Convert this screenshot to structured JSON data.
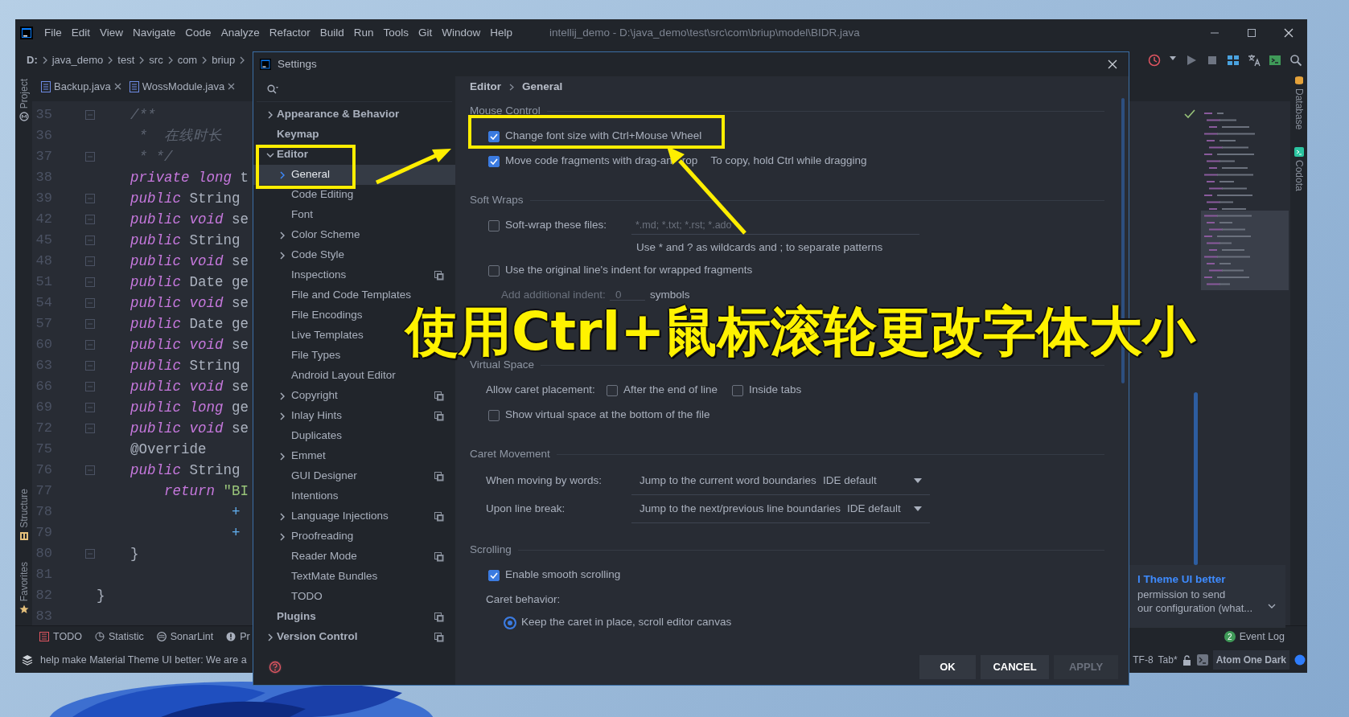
{
  "ide": {
    "menu": [
      "File",
      "Edit",
      "View",
      "Navigate",
      "Code",
      "Analyze",
      "Refactor",
      "Build",
      "Run",
      "Tools",
      "Git",
      "Window",
      "Help"
    ],
    "title": "intellij_demo - D:\\java_demo\\test\\src\\com\\briup\\model\\BIDR.java",
    "breadcrumbs": [
      "D:",
      "java_demo",
      "test",
      "src",
      "com",
      "briup"
    ],
    "tabs": [
      {
        "label": "Backup.java",
        "selected": false
      },
      {
        "label": "WossModule.java",
        "selected": false
      }
    ],
    "left_tools": [
      "Project",
      "Structure",
      "Favorites"
    ],
    "right_tools": [
      "Database",
      "Codota"
    ],
    "code_lines": [
      {
        "number": "35",
        "fold": true,
        "tokens": [
          {
            "kind": "comment",
            "text": "    /**"
          }
        ]
      },
      {
        "number": "36",
        "fold": false,
        "tokens": [
          {
            "kind": "comment",
            "text": "     *  在线时长"
          }
        ]
      },
      {
        "number": "37",
        "fold": true,
        "tokens": [
          {
            "kind": "comment",
            "text": "     * */"
          }
        ]
      },
      {
        "number": "38",
        "fold": false,
        "tokens": [
          {
            "kind": "keyword",
            "text": "    private"
          },
          {
            "kind": "keyword",
            "text": " long"
          },
          {
            "kind": "plain",
            "text": " t"
          }
        ]
      },
      {
        "number": "39",
        "fold": true,
        "tokens": [
          {
            "kind": "keyword",
            "text": "    public"
          },
          {
            "kind": "plain",
            "text": " String"
          }
        ]
      },
      {
        "number": "42",
        "fold": true,
        "tokens": [
          {
            "kind": "keyword",
            "text": "    public"
          },
          {
            "kind": "keyword",
            "text": " void"
          },
          {
            "kind": "plain",
            "text": " se"
          }
        ]
      },
      {
        "number": "45",
        "fold": true,
        "tokens": [
          {
            "kind": "keyword",
            "text": "    public"
          },
          {
            "kind": "plain",
            "text": " String"
          }
        ]
      },
      {
        "number": "48",
        "fold": true,
        "tokens": [
          {
            "kind": "keyword",
            "text": "    public"
          },
          {
            "kind": "keyword",
            "text": " void"
          },
          {
            "kind": "plain",
            "text": " se"
          }
        ]
      },
      {
        "number": "51",
        "fold": true,
        "tokens": [
          {
            "kind": "keyword",
            "text": "    public"
          },
          {
            "kind": "plain",
            "text": " Date ge"
          }
        ]
      },
      {
        "number": "54",
        "fold": true,
        "tokens": [
          {
            "kind": "keyword",
            "text": "    public"
          },
          {
            "kind": "keyword",
            "text": " void"
          },
          {
            "kind": "plain",
            "text": " se"
          }
        ]
      },
      {
        "number": "57",
        "fold": true,
        "tokens": [
          {
            "kind": "keyword",
            "text": "    public"
          },
          {
            "kind": "plain",
            "text": " Date ge"
          }
        ]
      },
      {
        "number": "60",
        "fold": true,
        "tokens": [
          {
            "kind": "keyword",
            "text": "    public"
          },
          {
            "kind": "keyword",
            "text": " void"
          },
          {
            "kind": "plain",
            "text": " se"
          }
        ]
      },
      {
        "number": "63",
        "fold": true,
        "tokens": [
          {
            "kind": "keyword",
            "text": "    public"
          },
          {
            "kind": "plain",
            "text": " String"
          }
        ]
      },
      {
        "number": "66",
        "fold": true,
        "tokens": [
          {
            "kind": "keyword",
            "text": "    public"
          },
          {
            "kind": "keyword",
            "text": " void"
          },
          {
            "kind": "plain",
            "text": " se"
          }
        ]
      },
      {
        "number": "69",
        "fold": true,
        "tokens": [
          {
            "kind": "keyword",
            "text": "    public"
          },
          {
            "kind": "keyword",
            "text": " long"
          },
          {
            "kind": "plain",
            "text": " ge"
          }
        ]
      },
      {
        "number": "72",
        "fold": true,
        "tokens": [
          {
            "kind": "keyword",
            "text": "    public"
          },
          {
            "kind": "keyword",
            "text": " void"
          },
          {
            "kind": "plain",
            "text": " se"
          }
        ]
      },
      {
        "number": "75",
        "fold": false,
        "tokens": [
          {
            "kind": "plain",
            "text": "    @Override"
          }
        ]
      },
      {
        "number": "76",
        "fold": true,
        "tokens": [
          {
            "kind": "keyword",
            "text": "    public"
          },
          {
            "kind": "plain",
            "text": " String"
          }
        ]
      },
      {
        "number": "77",
        "fold": false,
        "tokens": [
          {
            "kind": "keyword",
            "text": "        return"
          },
          {
            "kind": "string",
            "text": " \"BI"
          }
        ]
      },
      {
        "number": "78",
        "fold": false,
        "tokens": [
          {
            "kind": "operator",
            "text": "                +"
          }
        ]
      },
      {
        "number": "79",
        "fold": false,
        "tokens": [
          {
            "kind": "operator",
            "text": "                +"
          }
        ]
      },
      {
        "number": "80",
        "fold": true,
        "tokens": [
          {
            "kind": "plain",
            "text": "    }"
          }
        ]
      },
      {
        "number": "81",
        "fold": false
      },
      {
        "number": "82",
        "fold": false,
        "tokens": [
          {
            "kind": "plain",
            "text": "}"
          }
        ]
      },
      {
        "number": "83",
        "fold": false
      }
    ],
    "notification": {
      "title": "l Theme UI better",
      "lines": [
        "permission to send",
        "our configuration (what..."
      ]
    },
    "bottom_tools": [
      "TODO",
      "Statistic",
      "SonarLint",
      "Pr"
    ],
    "event_log": {
      "count": "2",
      "label": "Event Log"
    },
    "status": {
      "message": "help make Material Theme UI better: We are a",
      "encoding": "TF-8",
      "indent": "Tab*",
      "theme": "Atom One Dark"
    }
  },
  "settings": {
    "title": "Settings",
    "tree": [
      {
        "label": "Appearance & Behavior",
        "kind": "group",
        "expanded": false,
        "selected": false,
        "project": false
      },
      {
        "label": "Keymap",
        "kind": "page",
        "selected": false,
        "project": false
      },
      {
        "label": "Editor",
        "kind": "group",
        "expanded": true,
        "selected": false,
        "project": false,
        "children": [
          {
            "label": "General",
            "kind": "group",
            "expanded": false,
            "selected": true,
            "project": false
          },
          {
            "label": "Code Editing",
            "kind": "page",
            "selected": false,
            "project": false
          },
          {
            "label": "Font",
            "kind": "page",
            "selected": false,
            "project": false
          },
          {
            "label": "Color Scheme",
            "kind": "group",
            "expanded": false,
            "selected": false,
            "project": false
          },
          {
            "label": "Code Style",
            "kind": "group",
            "expanded": false,
            "selected": false,
            "project": false
          },
          {
            "label": "Inspections",
            "kind": "page",
            "selected": false,
            "project": true
          },
          {
            "label": "File and Code Templates",
            "kind": "page",
            "selected": false,
            "project": false
          },
          {
            "label": "File Encodings",
            "kind": "page",
            "selected": false,
            "project": false
          },
          {
            "label": "Live Templates",
            "kind": "page",
            "selected": false,
            "project": false
          },
          {
            "label": "File Types",
            "kind": "page",
            "selected": false,
            "project": false
          },
          {
            "label": "Android Layout Editor",
            "kind": "page",
            "selected": false,
            "project": false
          },
          {
            "label": "Copyright",
            "kind": "group",
            "expanded": false,
            "selected": false,
            "project": true
          },
          {
            "label": "Inlay Hints",
            "kind": "group",
            "expanded": false,
            "selected": false,
            "project": true
          },
          {
            "label": "Duplicates",
            "kind": "page",
            "selected": false,
            "project": false
          },
          {
            "label": "Emmet",
            "kind": "group",
            "expanded": false,
            "selected": false,
            "project": false
          },
          {
            "label": "GUI Designer",
            "kind": "page",
            "selected": false,
            "project": true
          },
          {
            "label": "Intentions",
            "kind": "page",
            "selected": false,
            "project": false
          },
          {
            "label": "Language Injections",
            "kind": "group",
            "expanded": false,
            "selected": false,
            "project": true
          },
          {
            "label": "Proofreading",
            "kind": "group",
            "expanded": false,
            "selected": false,
            "project": false
          },
          {
            "label": "Reader Mode",
            "kind": "page",
            "selected": false,
            "project": true
          },
          {
            "label": "TextMate Bundles",
            "kind": "page",
            "selected": false,
            "project": false
          },
          {
            "label": "TODO",
            "kind": "page",
            "selected": false,
            "project": false
          }
        ]
      },
      {
        "label": "Plugins",
        "kind": "page",
        "selected": false,
        "project": true
      },
      {
        "label": "Version Control",
        "kind": "group",
        "expanded": false,
        "selected": false,
        "project": true
      }
    ],
    "breadcrumb": [
      "Editor",
      "General"
    ],
    "sections": [
      {
        "title": "Mouse Control",
        "rows": [
          {
            "kind": "checkbox",
            "label": "Change font size with Ctrl+Mouse Wheel",
            "checked": true
          },
          {
            "kind": "checkbox",
            "label": "Move code fragments with drag-an",
            "label_tail": "rop",
            "checked": true,
            "note": "To copy, hold Ctrl while dragging"
          }
        ]
      },
      {
        "title": "Soft Wraps",
        "rows": [
          {
            "kind": "checkbox_field",
            "label": "Soft-wrap these files:",
            "checked": false,
            "placeholder": "*.md; *.txt; *.rst; *.ado"
          },
          {
            "kind": "hint",
            "text": "Use * and ? as wildcards and ; to separate patterns"
          },
          {
            "kind": "checkbox",
            "label": "Use the original line's indent for wrapped fragments",
            "checked": false
          },
          {
            "kind": "number_field",
            "label": "Add additional indent:",
            "value": "0",
            "unit": "symbols",
            "disabled": true
          }
        ]
      },
      {
        "title": "Virtual Space",
        "rows": [
          {
            "kind": "checkbox_group",
            "label": "Allow caret placement:",
            "options": [
              {
                "label": "After the end of line",
                "checked": false
              },
              {
                "label": "Inside tabs",
                "checked": false
              }
            ]
          },
          {
            "kind": "checkbox",
            "label": "Show virtual space at the bottom of the file",
            "checked": false
          }
        ]
      },
      {
        "title": "Caret Movement",
        "rows": [
          {
            "kind": "combo",
            "label": "When moving by words:",
            "value": "Jump to the current word boundaries",
            "hint": "IDE default"
          },
          {
            "kind": "combo",
            "label": "Upon line break:",
            "value": "Jump to the next/previous line boundaries",
            "hint": "IDE default"
          }
        ]
      },
      {
        "title": "Scrolling",
        "rows": [
          {
            "kind": "checkbox",
            "label": "Enable smooth scrolling",
            "checked": true
          },
          {
            "kind": "label",
            "text": "Caret behavior:"
          },
          {
            "kind": "radio",
            "label": "Keep the caret in place, scroll editor canvas",
            "selected": true
          }
        ]
      }
    ],
    "buttons": [
      {
        "label": "OK",
        "disabled": false
      },
      {
        "label": "CANCEL",
        "disabled": false
      },
      {
        "label": "APPLY",
        "disabled": true
      }
    ]
  },
  "caption": "使用Ctrl+鼠标滚轮更改字体大小"
}
